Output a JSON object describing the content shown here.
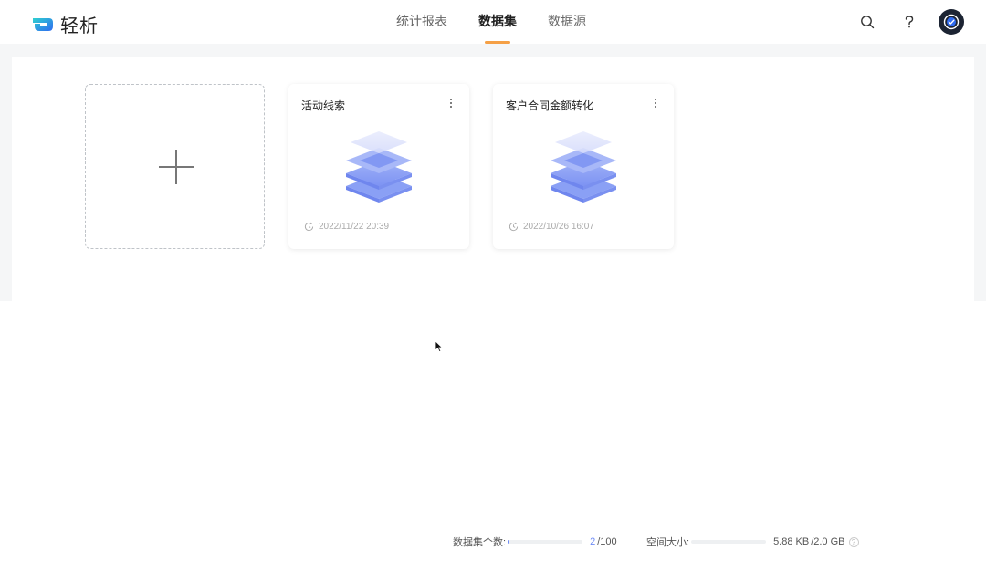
{
  "app": {
    "name": "轻析"
  },
  "nav": {
    "tabs": [
      {
        "label": "统计报表",
        "active": false
      },
      {
        "label": "数据集",
        "active": true
      },
      {
        "label": "数据源",
        "active": false
      }
    ]
  },
  "header_icons": [
    "search-icon",
    "help-icon",
    "avatar"
  ],
  "datasets": [
    {
      "title": "活动线索",
      "updated": "2022/11/22 20:39"
    },
    {
      "title": "客户合同金额转化",
      "updated": "2022/10/26 16:07"
    }
  ],
  "footer": {
    "dataset_count_label": "数据集个数:",
    "dataset_count_used": "2",
    "dataset_count_total": "/100",
    "dataset_count_fraction": 0.02,
    "space_label": "空间大小:",
    "space_used": "5.88 KB",
    "space_total": "/2.0 GB",
    "space_fraction": 0.0
  },
  "colors": {
    "accent": "#f5a046",
    "brand_blue": "#2f6bf0",
    "progress": "#6f8cf5"
  }
}
